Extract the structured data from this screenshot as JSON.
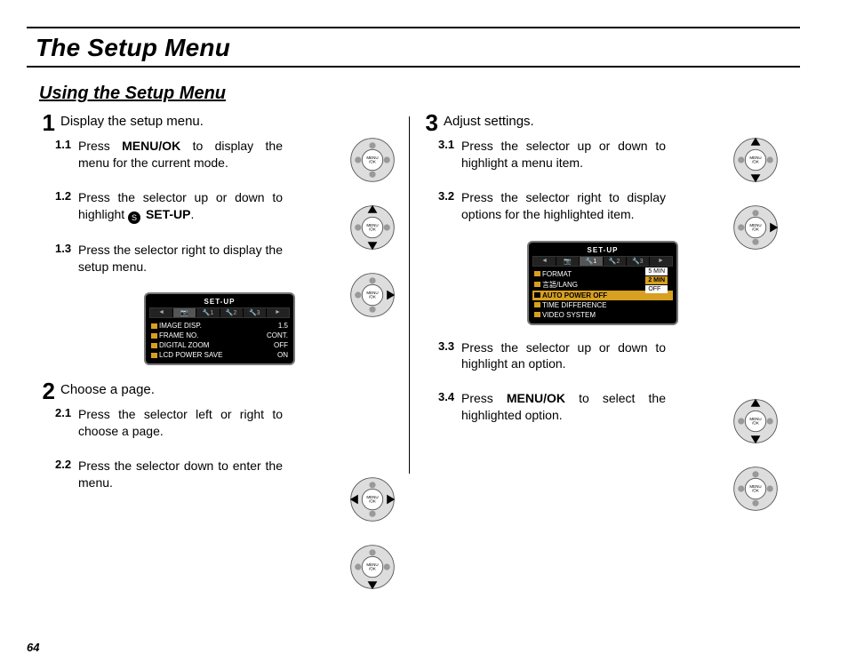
{
  "page_number": "64",
  "title": "The Setup Menu",
  "subtitle": "Using the Setup Menu",
  "selector_center": "MENU/OK",
  "left": {
    "step1": {
      "num": "1",
      "head": "Display the setup menu.",
      "s1": {
        "num": "1.1",
        "pre": "Press ",
        "bold": "MENU/OK",
        "post": " to display the menu for the current mode."
      },
      "s2": {
        "num": "1.2",
        "pre": "Press the selector up or down to highlight ",
        "icon": "SET",
        "bold": "SET-UP",
        "post": "."
      },
      "s3": {
        "num": "1.3",
        "txt": "Press the selector right to display the setup menu."
      }
    },
    "lcd": {
      "title": "SET-UP",
      "rows": [
        {
          "k": "IMAGE DISP.",
          "v": "1.5"
        },
        {
          "k": "FRAME NO.",
          "v": "CONT."
        },
        {
          "k": "DIGITAL ZOOM",
          "v": "OFF"
        },
        {
          "k": "LCD POWER SAVE",
          "v": "ON"
        }
      ]
    },
    "step2": {
      "num": "2",
      "head": "Choose a page.",
      "s1": {
        "num": "2.1",
        "txt": "Press the selector left or right to choose a page."
      },
      "s2": {
        "num": "2.2",
        "txt": "Press the selector down to enter the menu."
      }
    }
  },
  "right": {
    "step3": {
      "num": "3",
      "head": "Adjust settings.",
      "s1": {
        "num": "3.1",
        "txt": "Press the selector up or down to highlight a menu item."
      },
      "s2": {
        "num": "3.2",
        "txt": "Press the selector right to display options for the highlighted item."
      },
      "s3": {
        "num": "3.3",
        "txt": "Press the selector up or down to highlight an option."
      },
      "s4": {
        "num": "3.4",
        "pre": "Press ",
        "bold": "MENU/OK",
        "post": " to select the highlighted option."
      }
    },
    "lcd": {
      "title": "SET-UP",
      "rows": [
        {
          "k": "FORMAT"
        },
        {
          "k": "言語/LANG"
        },
        {
          "k": "AUTO POWER OFF",
          "active": true
        },
        {
          "k": "TIME DIFFERENCE"
        },
        {
          "k": "VIDEO SYSTEM"
        }
      ],
      "opts": [
        {
          "v": "5 MIN"
        },
        {
          "v": "2 MIN",
          "sel": true
        },
        {
          "v": "OFF"
        }
      ]
    }
  }
}
